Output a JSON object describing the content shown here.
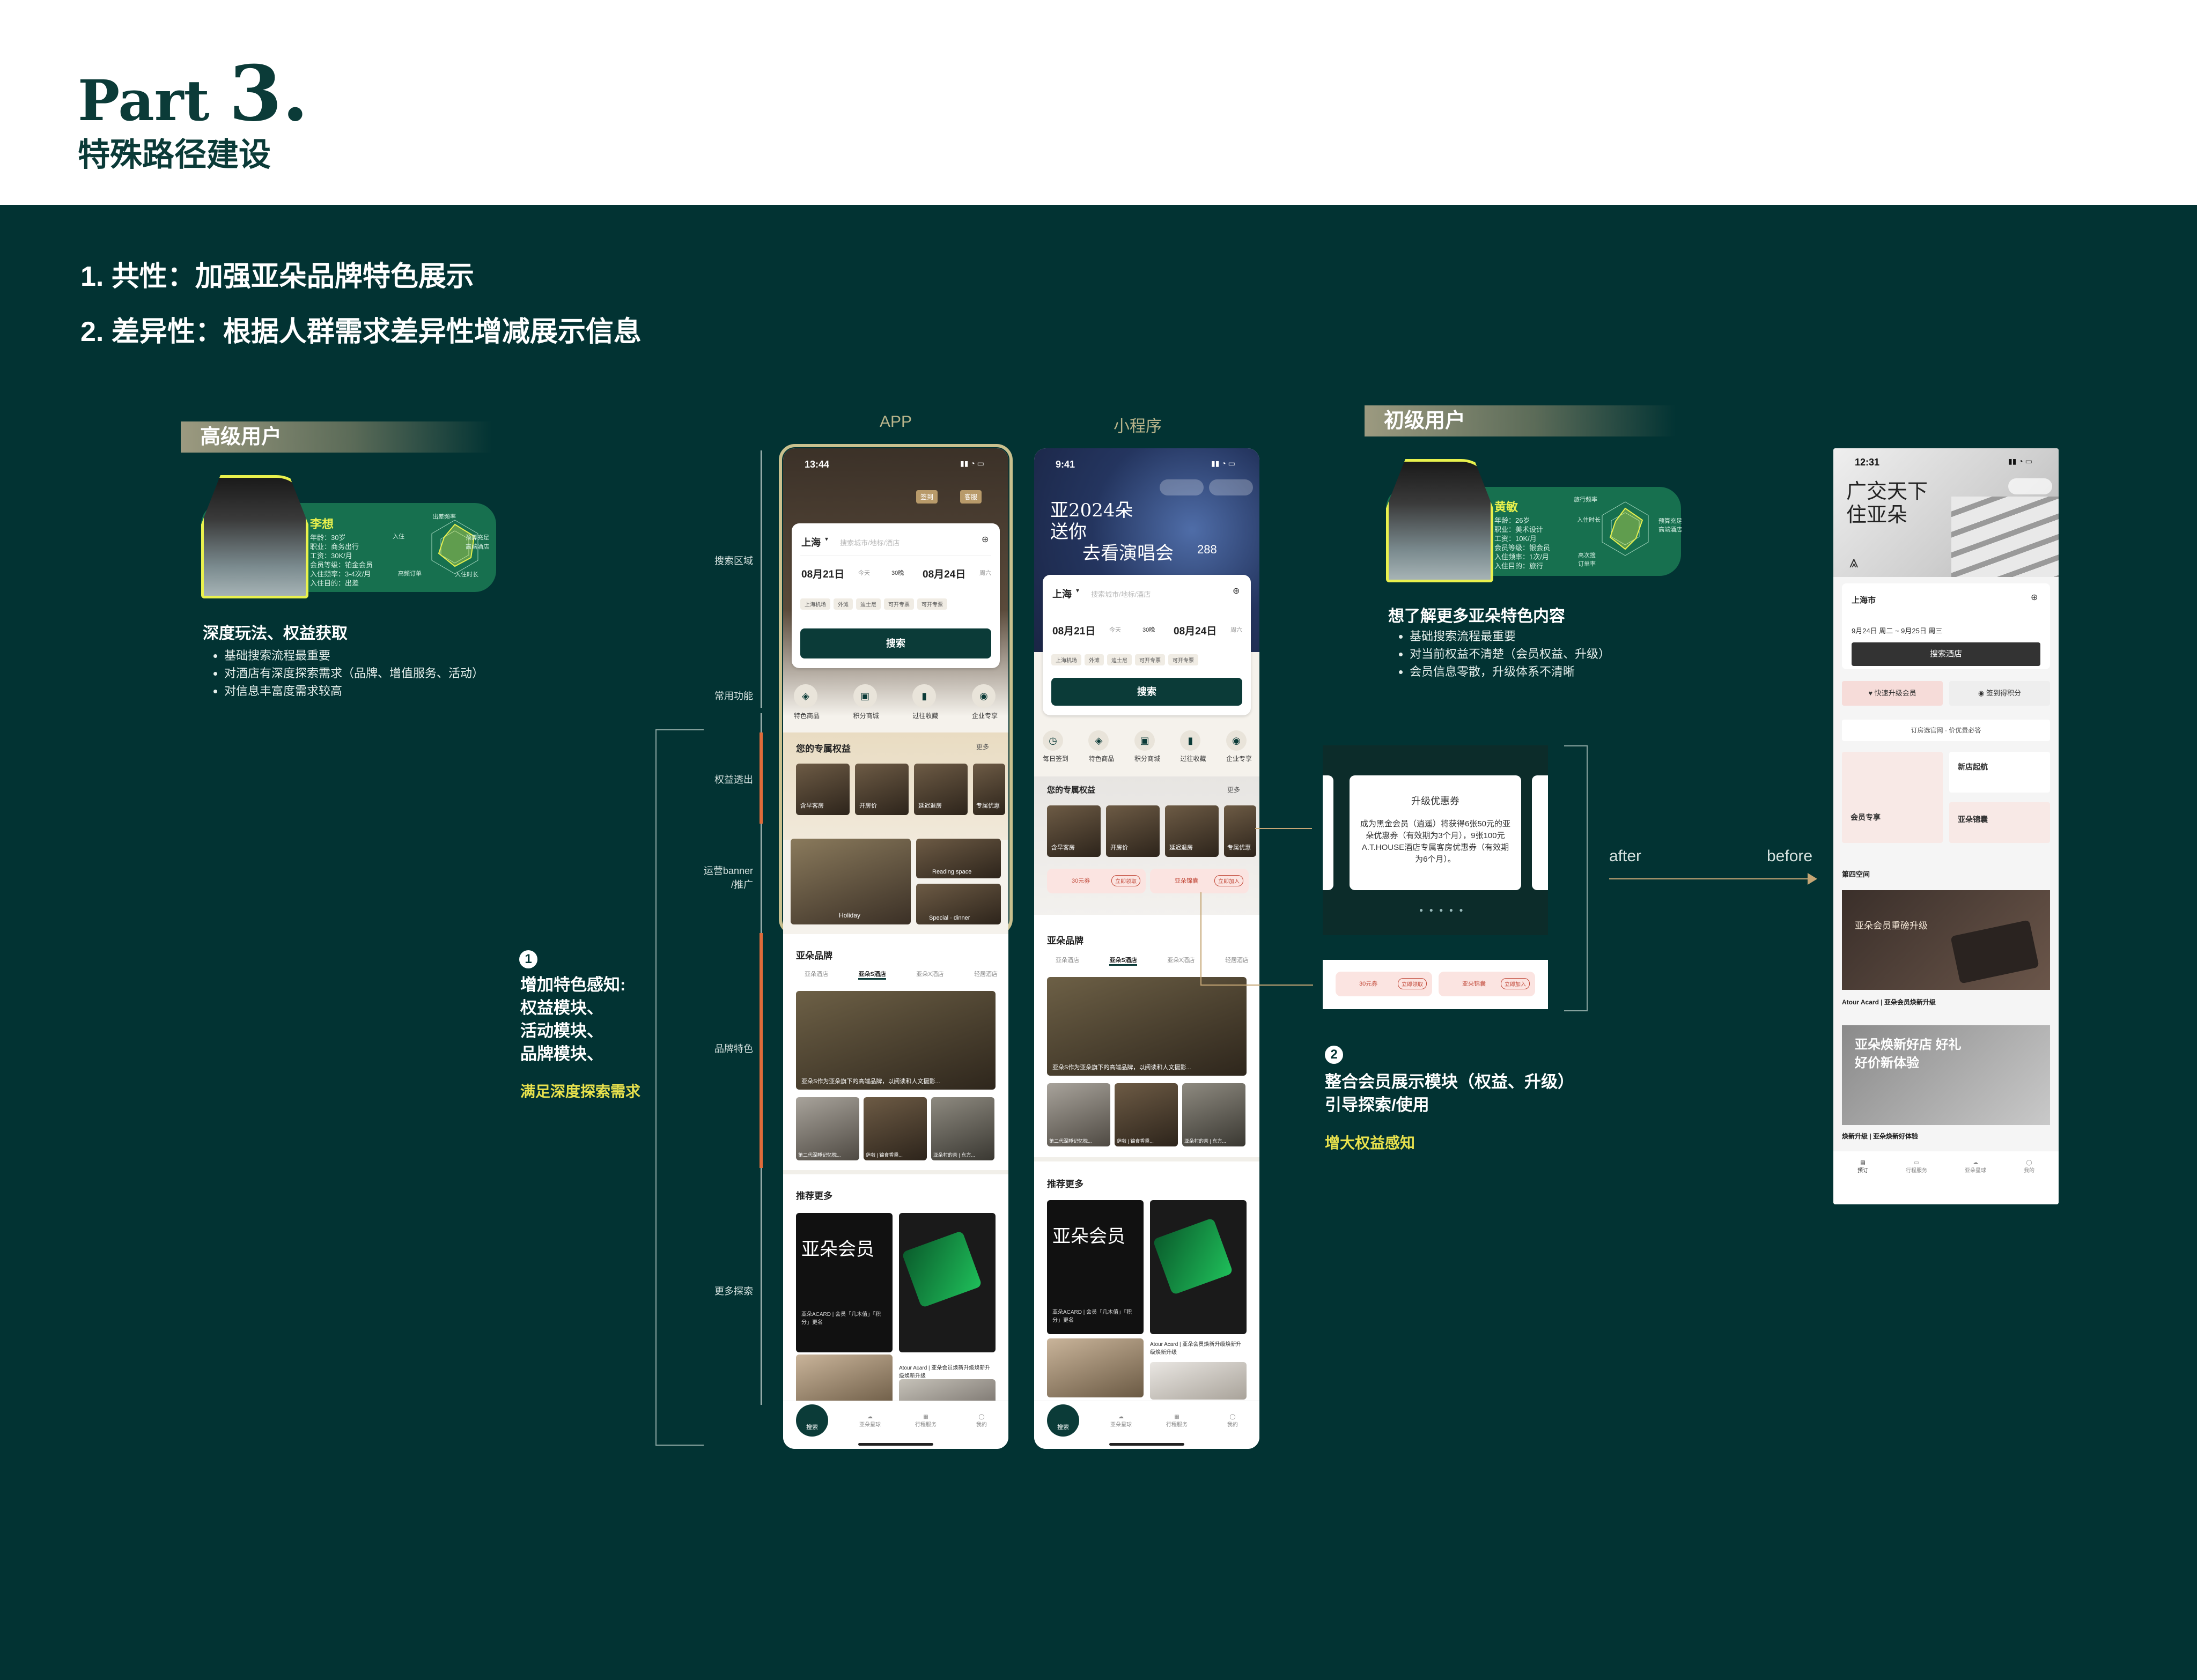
{
  "header": {
    "part_word": "Part",
    "part_num": "3.",
    "subtitle": "特殊路径建设"
  },
  "points": [
    "1. 共性：加强亚朵品牌特色展示",
    "2. 差异性：根据人群需求差异性增减展示信息"
  ],
  "senior": {
    "tag": "高级用户",
    "name": "李想",
    "meta": [
      "年龄：30岁",
      "职业：商务出行",
      "工资：30K/月",
      "会员等级：铂金会员",
      "入住频率：3-4次/月",
      "入住目的：出差"
    ],
    "radar_labels": [
      "出差频率",
      "预算充足",
      "高端酒店",
      "入住时长",
      "高频订单",
      "入住"
    ],
    "desc_title": "深度玩法、权益获取",
    "desc_list": [
      "基础搜索流程最重要",
      "对酒店有深度探索需求（品牌、增值服务、活动）",
      "对信息丰富度需求较高"
    ]
  },
  "junior": {
    "tag": "初级用户",
    "name": "黄敏",
    "meta": [
      "年龄：26岁",
      "职业：美术设计",
      "工资：10K/月",
      "会员等级：银会员",
      "入住频率：1次/月",
      "入住目的：旅行"
    ],
    "radar_labels": [
      "旅行频率",
      "预算充足",
      "高端酒店",
      "高次搜",
      "订单率",
      "入住时长"
    ],
    "desc_title": "想了解更多亚朵特色内容",
    "desc_list": [
      "基础搜索流程最重要",
      "对当前权益不清楚（会员权益、升级）",
      "会员信息零散，升级体系不清晰"
    ]
  },
  "labels": {
    "app": "APP",
    "mini": "小程序",
    "after": "after",
    "before": "before"
  },
  "markers": [
    "搜索区域",
    "常用功能",
    "权益透出",
    "运营banner\n/推广",
    "品牌特色",
    "更多探索"
  ],
  "annot1": {
    "num": "1",
    "lines": [
      "增加特色感知:",
      "权益模块、",
      "活动模块、",
      "品牌模块、"
    ],
    "highlight": "满足深度探索需求"
  },
  "annot2": {
    "num": "2",
    "lines": [
      "整合会员展示模块（权益、升级）",
      "引导探索/使用"
    ],
    "highlight": "增大权益感知"
  },
  "app": {
    "time": "13:44",
    "top_btns": [
      "签到",
      "客服"
    ],
    "city": "上海",
    "search_ph": "搜索城市/地标/酒店",
    "date_from": "08月21日",
    "date_from_sub": "今天",
    "nights": "30晚",
    "date_to": "08月24日",
    "date_to_sub": "周六",
    "chips": [
      "上海机场",
      "外滩",
      "迪士尼",
      "可开专票",
      "可开专票"
    ],
    "search_btn": "搜索",
    "quick": [
      "特色商品",
      "积分商城",
      "过往收藏",
      "企业专享"
    ],
    "rights_title": "您的专属权益",
    "rights_more": "更多",
    "rights_items": [
      "含早客房",
      "开房价",
      "延迟退房",
      "专属优惠"
    ],
    "banner_labels": [
      "Holiday",
      "Reading space",
      "Special · dinner"
    ],
    "brand_title": "亚朵品牌",
    "brand_tabs": [
      "亚朵酒店",
      "亚朵S酒店",
      "亚朵X酒店",
      "轻居酒店"
    ],
    "brand_caption": "亚朵S作为亚朵旗下的高端品牌，以阅读和人文摄影...",
    "brand_thumbs": [
      "第二代深睡记忆枕...",
      "萨啦 | 锦食香熏...",
      "亚朵村的茶 | 东方..."
    ],
    "more_title": "推荐更多",
    "more_items": [
      "亚朵ACARD | 会员「几木值」「积分」更名",
      "Atour Acard | 亚朵会员焕新升级焕新升级焕新升级"
    ],
    "nav": [
      "搜索",
      "亚朵星球",
      "行程服务",
      "我的"
    ]
  },
  "mini": {
    "time": "9:41",
    "hero_text": [
      "亚2024朵",
      "送你",
      "去看演唱会"
    ],
    "hero_badge": "288",
    "city": "上海",
    "search_ph": "搜索城市/地标/酒店",
    "date_from": "08月21日",
    "date_from_sub": "今天",
    "nights": "30晚",
    "date_to": "08月24日",
    "date_to_sub": "周六",
    "chips": [
      "上海机场",
      "外滩",
      "迪士尼",
      "可开专票",
      "可开专票"
    ],
    "search_btn": "搜索",
    "quick": [
      "每日签到",
      "特色商品",
      "积分商城",
      "过往收藏",
      "企业专享"
    ],
    "rights_title": "您的专属权益",
    "rights_more": "更多",
    "rights_items": [
      "含早客房",
      "开房价",
      "延迟退房",
      "专属优惠"
    ],
    "coupons": [
      {
        "t": "30元券",
        "b": "立即领取"
      },
      {
        "t": "亚朵锦囊",
        "b": "立即加入"
      }
    ],
    "brand_title": "亚朵品牌",
    "brand_tabs": [
      "亚朵酒店",
      "亚朵S酒店",
      "亚朵X酒店",
      "轻居酒店"
    ],
    "brand_caption": "亚朵S作为亚朵旗下的高端品牌，以阅读和人文摄影...",
    "brand_thumbs": [
      "第二代深睡记忆枕...",
      "萨啦 | 锦食香熏...",
      "亚朵村的茶 | 东方..."
    ],
    "more_title": "推荐更多",
    "more_items": [
      "亚朵ACARD | 会员「几木值」「积分」更名",
      "Atour Acard | 亚朵会员焕新升级焕新升级焕新升级"
    ],
    "nav": [
      "搜索",
      "亚朵星球",
      "行程服务",
      "我的"
    ]
  },
  "upgrade": {
    "title": "升级优惠券",
    "body": "成为黑金会员（逍遥）将获得6张50元的亚朵优惠券（有效期为3个月），9张100元A.T.HOUSE酒店专属客房优惠券（有效期为6个月）。"
  },
  "coupon_row": [
    {
      "t": "30元券",
      "b": "立即领取"
    },
    {
      "t": "亚朵锦囊",
      "b": "立即加入"
    }
  ],
  "before_phone": {
    "time": "12:31",
    "hero_lines": [
      "广交天下",
      "住亚朵"
    ],
    "city": "上海市",
    "dates": "9月24日 周二 ~ 9月25日 周三",
    "search_btn": "搜索酒店",
    "actions": [
      "快速升级会员",
      "签到得积分"
    ],
    "notice": "订房选官网 · 价优贵必答",
    "cards": [
      "会员专享",
      "新店起航",
      "亚朵锦囊"
    ],
    "section": "第四空间",
    "banner1_caption": "Atour Acard | 亚朵会员焕新升级",
    "banner1_text": "亚朵会员重磅升级",
    "banner2_caption": "焕新升级 | 亚朵焕新好体验",
    "banner2_text": "亚朵焕新好店 好礼好价新体验",
    "nav": [
      "预订",
      "行程服务",
      "亚朵星球",
      "我的"
    ]
  }
}
